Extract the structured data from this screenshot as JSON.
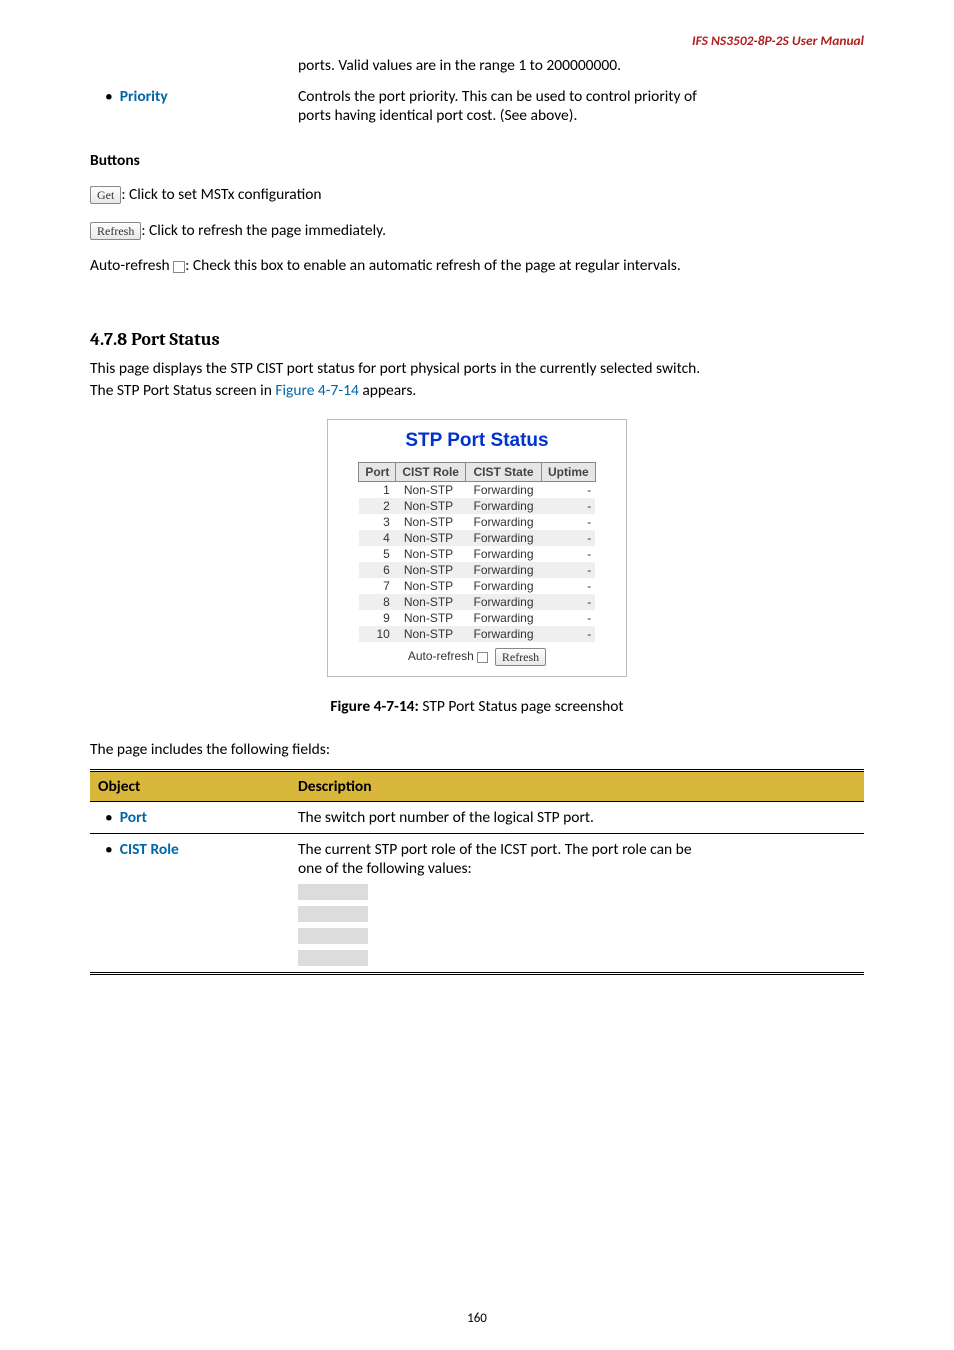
{
  "header": {
    "manual_title": "IFS  NS3502-8P-2S  User  Manual"
  },
  "top_table": {
    "row1_col2": "ports. Valid values are in the range 1 to 200000000.",
    "row2_bullet": "•",
    "row2_label": "Priority",
    "row2_col2a": "Controls the port priority. This can be used to control priority of",
    "row2_col2b": "ports having identical port cost. (See above)."
  },
  "buttons_heading": "Buttons",
  "btn_get": "Get",
  "btn_get_desc": ": Click to set MSTx configuration",
  "btn_refresh": "Refresh",
  "btn_refresh_desc": ": Click to refresh the page immediately.",
  "auto_refresh_line_a": "Auto-refresh ",
  "auto_refresh_line_b": ": Check this box to enable an automatic refresh of the page at regular intervals.",
  "section_heading": "4.7.8 Port Status",
  "section_p1a": "This page displays the STP CIST port status for port physical ports in the currently selected switch.",
  "section_p1b_a": "The STP Port Status screen in ",
  "section_p1b_ref": "Figure 4-7-14",
  "section_p1b_b": " appears.",
  "stp": {
    "title": "STP Port Status",
    "headers": {
      "port": "Port",
      "role": "CIST Role",
      "state": "CIST State",
      "uptime": "Uptime"
    },
    "rows": [
      {
        "port": "1",
        "role": "Non-STP",
        "state": "Forwarding",
        "uptime": "-"
      },
      {
        "port": "2",
        "role": "Non-STP",
        "state": "Forwarding",
        "uptime": "-"
      },
      {
        "port": "3",
        "role": "Non-STP",
        "state": "Forwarding",
        "uptime": "-"
      },
      {
        "port": "4",
        "role": "Non-STP",
        "state": "Forwarding",
        "uptime": "-"
      },
      {
        "port": "5",
        "role": "Non-STP",
        "state": "Forwarding",
        "uptime": "-"
      },
      {
        "port": "6",
        "role": "Non-STP",
        "state": "Forwarding",
        "uptime": "-"
      },
      {
        "port": "7",
        "role": "Non-STP",
        "state": "Forwarding",
        "uptime": "-"
      },
      {
        "port": "8",
        "role": "Non-STP",
        "state": "Forwarding",
        "uptime": "-"
      },
      {
        "port": "9",
        "role": "Non-STP",
        "state": "Forwarding",
        "uptime": "-"
      },
      {
        "port": "10",
        "role": "Non-STP",
        "state": "Forwarding",
        "uptime": "-"
      }
    ],
    "footer_label": "Auto-refresh",
    "footer_btn": "Refresh"
  },
  "fig_caption_bold": "Figure 4-7-14:",
  "fig_caption_rest": " STP Port Status page screenshot",
  "fields_intro": "The page includes the following fields:",
  "obj_table": {
    "h1": "Object",
    "h2": "Description",
    "row1_bullet": "•",
    "row1_label": "Port",
    "row1_desc": "The switch port number of the logical STP port.",
    "row2_bullet": "•",
    "row2_label": "CIST Role",
    "row2_desc_a": "The current STP port role of the ICST port. The port role can be",
    "row2_desc_b": "one of the following values:"
  },
  "page_number": "160"
}
